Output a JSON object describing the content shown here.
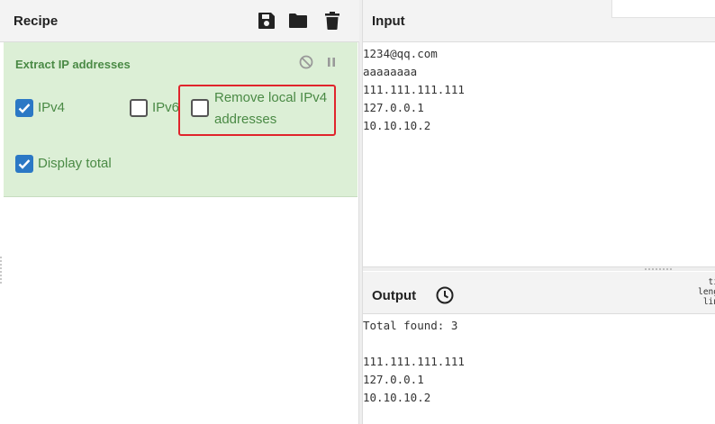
{
  "recipe": {
    "title": "Recipe",
    "header_icons": [
      "save-icon",
      "folder-icon",
      "trash-icon"
    ],
    "operation": {
      "name": "Extract IP addresses",
      "options": [
        {
          "label": "IPv4",
          "checked": true
        },
        {
          "label": "IPv6",
          "checked": false
        },
        {
          "label_line1": "Remove local IPv4",
          "label_line2": "addresses",
          "checked": false
        },
        {
          "label": "Display total",
          "checked": true
        }
      ]
    }
  },
  "input": {
    "title": "Input",
    "lines": [
      "1234@qq.com",
      "aaaaaaaa",
      "111.111.111.111",
      "127.0.0.1",
      "10.10.10.2"
    ]
  },
  "output": {
    "title": "Output",
    "stats": [
      "ti",
      "leng",
      "lin"
    ],
    "lines": [
      "Total found: 3",
      "",
      "111.111.111.111",
      "127.0.0.1",
      "10.10.10.2"
    ]
  },
  "colors": {
    "operation_bg": "#dcefd6",
    "operation_text": "#4a8a45",
    "checkbox_checked": "#2b78c5",
    "highlight": "#e0242c"
  }
}
